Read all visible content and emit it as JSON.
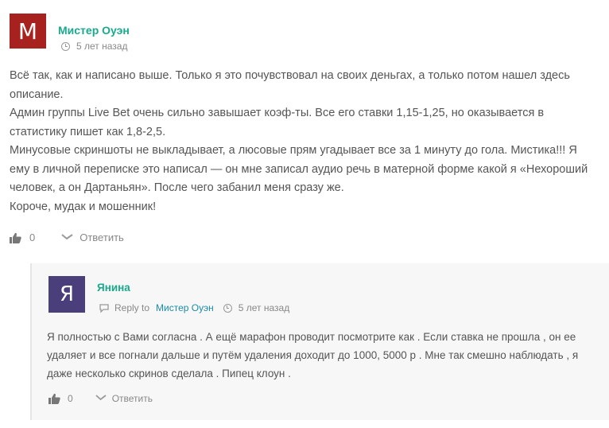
{
  "comment": {
    "avatar_letter": "М",
    "avatar_color": "#a7221e",
    "author": "Мистер Оуэн",
    "time": "5 лет назад",
    "paragraphs": [
      "Всё так, как и написано выше. Только я это почувствовал на своих деньгах, а только потом нашел здесь описание.",
      "Админ группы Live Bet очень сильно завышает коэф-ты. Все его ставки 1,15-1,25, но оказывается в статистику пишет как 1,8-2,5.",
      "Минусовые скриншоты не выкладывает, а люсовые прям угадывает все за 1 минуту до гола. Мистика!!! Я ему в личной переписке это написал — он мне записал аудио речь в матерной форме какой я «Нехороший человек, а он Дартаньян». После чего забанил меня сразу же.",
      "Короче, мудак и мошенник!"
    ],
    "likes": "0",
    "reply_label": "Ответить"
  },
  "reply": {
    "avatar_letter": "Я",
    "avatar_color": "#4a3f7a",
    "author": "Янина",
    "reply_to_label": "Reply to",
    "reply_to_author": "Мистер Оуэн",
    "time": "5 лет назад",
    "text": "Я полностью с Вами согласна . А ещё марафон проводит посмотрите как . Если ставка не прошла , он ее удаляет и все погнали дальше и путём удаления доходит до 1000, 5000 р . Мне так смешно наблюдать , я даже несколько скринов сделала . Пипец клоун .",
    "likes": "0",
    "reply_label": "Ответить"
  },
  "colors": {
    "accent": "#1aa98c",
    "link": "#1a8ca9",
    "reply_bg": "#f7f7f7"
  }
}
